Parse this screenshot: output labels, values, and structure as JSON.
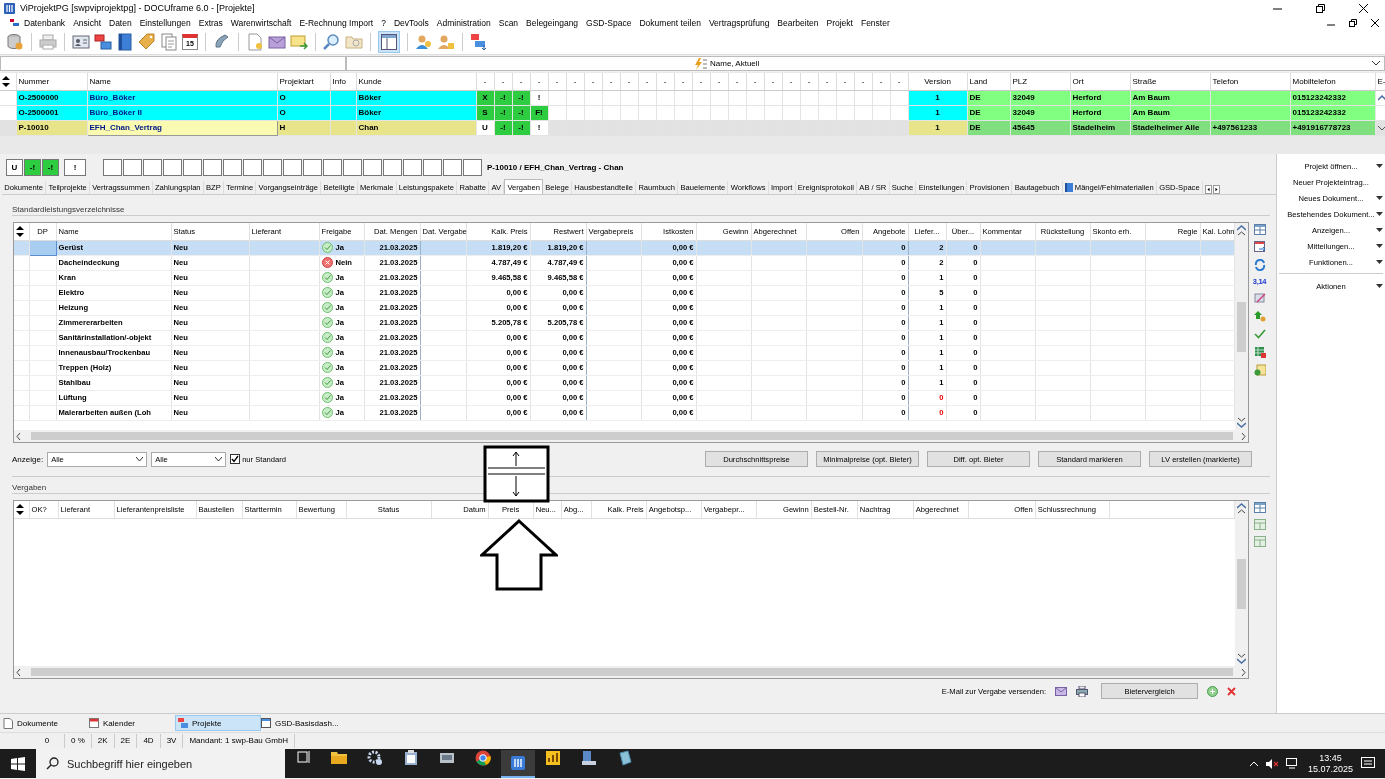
{
  "window": {
    "title": "ViProjektPG [swpviprojektpg] - DOCUframe 6.0 - [Projekte]"
  },
  "menu": [
    "Datenbank",
    "Ansicht",
    "Daten",
    "Einstellungen",
    "Extras",
    "Warenwirtschaft",
    "E-Rechnung Import",
    "?",
    "DevTools",
    "Administration",
    "Scan",
    "Belegeingang",
    "GSD-Space",
    "Dokument teilen",
    "Vertragsprüfung",
    "Bearbeiten",
    "Projekt",
    "Fenster"
  ],
  "toolbar": {
    "calendar_day": "15"
  },
  "filter_bar": {
    "sort_value": "Name, Aktuell"
  },
  "projects": {
    "columns": [
      "Nummer",
      "Name",
      "Projektart",
      "Info",
      "Kunde"
    ],
    "flag_columns": [
      "-",
      "-",
      "-",
      "-",
      "-",
      "-",
      "-",
      "-",
      "-",
      "-",
      "-",
      "-",
      "-",
      "-",
      "-",
      "-",
      "-",
      "-",
      "-",
      "-",
      "-",
      "-",
      "-",
      "-"
    ],
    "address_columns": [
      "Version",
      "Land",
      "PLZ",
      "Ort",
      "Straße",
      "Telefon",
      "Mobiltelefon",
      "E-"
    ],
    "rows": [
      {
        "nummer": "O-2500000",
        "name": "Büro_Böker",
        "projektart": "O",
        "kunde": "Böker",
        "color": "#00ffff",
        "selected": false,
        "flags": [
          {
            "text": "X",
            "on": true
          },
          {
            "text": "-!",
            "on": true
          },
          {
            "text": "-!",
            "on": true
          },
          {
            "text": "!",
            "on": false
          }
        ],
        "version": "1",
        "land": "DE",
        "plz": "32049",
        "ort": "Herford",
        "strasse": "Am Baum",
        "mobil": "015123242332"
      },
      {
        "nummer": "O-2500001",
        "name": "Büro_Böker II",
        "projektart": "O",
        "kunde": "Böker",
        "color": "#00ffff",
        "selected": false,
        "flags": [
          {
            "text": "S",
            "on": true
          },
          {
            "text": "-!",
            "on": true
          },
          {
            "text": "-!",
            "on": true
          },
          {
            "text": "F!",
            "on": true
          }
        ],
        "version": "1",
        "land": "DE",
        "plz": "32049",
        "ort": "Herford",
        "strasse": "Am Baum",
        "mobil": "015123242332"
      },
      {
        "nummer": "P-10010",
        "name": "EFH_Chan_Vertrag",
        "projektart": "H",
        "kunde": "Chan",
        "color": "#e8e48a",
        "selected": true,
        "flags": [
          {
            "text": "U",
            "on": false
          },
          {
            "text": "-!",
            "on": true
          },
          {
            "text": "-!",
            "on": true
          },
          {
            "text": "!",
            "on": false
          }
        ],
        "version": "1",
        "land": "DE",
        "plz": "45645",
        "ort": "Stadelheim",
        "strasse": "Stadelheimer Alle",
        "telefon": "+497561233",
        "mobil": "+491916778723"
      }
    ]
  },
  "project_header": {
    "status_boxes": [
      {
        "text": "U",
        "on": false
      },
      {
        "text": "-!",
        "on": true
      },
      {
        "text": "-!",
        "on": true
      },
      {
        "text": "!",
        "on": false
      }
    ],
    "title": "P-10010 / EFH_Chan_Vertrag - Chan"
  },
  "tabs": [
    {
      "label": "Dokumente",
      "selected": false
    },
    {
      "label": "Teilprojekte",
      "selected": false
    },
    {
      "label": "Vertragssummen",
      "selected": false
    },
    {
      "label": "Zahlungsplan",
      "selected": false
    },
    {
      "label": "BZP",
      "selected": false
    },
    {
      "label": "Termine",
      "selected": false
    },
    {
      "label": "Vorgangseinträge",
      "selected": false
    },
    {
      "label": "Beteiligte",
      "selected": false
    },
    {
      "label": "Merkmale",
      "selected": false
    },
    {
      "label": "Leistungspakete",
      "selected": false
    },
    {
      "label": "Rabatte",
      "selected": false
    },
    {
      "label": "AV",
      "selected": false
    },
    {
      "label": "Vergaben",
      "selected": true
    },
    {
      "label": "Belege",
      "selected": false
    },
    {
      "label": "Hausbestandteile",
      "selected": false
    },
    {
      "label": "Raumbuch",
      "selected": false
    },
    {
      "label": "Bauelemente",
      "selected": false
    },
    {
      "label": "Workflows",
      "selected": false
    },
    {
      "label": "Import",
      "selected": false
    },
    {
      "label": "Ereignisprotokoll",
      "selected": false
    },
    {
      "label": "AB / SR",
      "selected": false
    },
    {
      "label": "Suche",
      "selected": false
    },
    {
      "label": "Einstellungen",
      "selected": false
    },
    {
      "label": "Provisionen",
      "selected": false
    },
    {
      "label": "Bautagebuch",
      "selected": false
    },
    {
      "label": "Mängel/Fehlmaterialien",
      "selected": false
    },
    {
      "label": "GSD-Space",
      "selected": false
    }
  ],
  "lv": {
    "title": "Standardleistungsverzeichnisse",
    "tool_number": "3,14",
    "columns": [
      "DP",
      "Name",
      "Status",
      "Lieferant",
      "Freigabe",
      "Dat. Mengen",
      "Dat. Vergabe",
      "Kalk. Preis",
      "Restwert",
      "Vergabepreis",
      "Istkosten",
      "Gewinn",
      "Abgerechnet",
      "Offen",
      "Angebote",
      "Liefer...",
      "Über...",
      "Kommentar",
      "Rückstellung",
      "Skonto erh.",
      "Regie",
      "Kal. Lohn"
    ],
    "rows": [
      {
        "name": "Gerüst",
        "status": "Neu",
        "freigabe": "Ja",
        "approved": true,
        "dat_mengen": "21.03.2025",
        "kalk_preis": "1.819,20 €",
        "restwert": "1.819,20 €",
        "istkosten": "0,00 €",
        "angebote": "0",
        "lieferanten": "2",
        "lieferanten_alert": false,
        "ueber": "0",
        "selected": true
      },
      {
        "name": "Dacheindeckung",
        "status": "Neu",
        "freigabe": "Nein",
        "approved": false,
        "dat_mengen": "21.03.2025",
        "kalk_preis": "4.787,49 €",
        "restwert": "4.787,49 €",
        "istkosten": "0,00 €",
        "angebote": "0",
        "lieferanten": "2",
        "lieferanten_alert": false,
        "ueber": "0",
        "selected": false
      },
      {
        "name": "Kran",
        "status": "Neu",
        "freigabe": "Ja",
        "approved": true,
        "dat_mengen": "21.03.2025",
        "kalk_preis": "9.465,58 €",
        "restwert": "9.465,58 €",
        "istkosten": "0,00 €",
        "angebote": "0",
        "lieferanten": "1",
        "lieferanten_alert": false,
        "ueber": "0",
        "selected": false
      },
      {
        "name": "Elektro",
        "status": "Neu",
        "freigabe": "Ja",
        "approved": true,
        "dat_mengen": "21.03.2025",
        "kalk_preis": "0,00 €",
        "restwert": "0,00 €",
        "istkosten": "0,00 €",
        "angebote": "0",
        "lieferanten": "5",
        "lieferanten_alert": false,
        "ueber": "0",
        "selected": false
      },
      {
        "name": "Heizung",
        "status": "Neu",
        "freigabe": "Ja",
        "approved": true,
        "dat_mengen": "21.03.2025",
        "kalk_preis": "0,00 €",
        "restwert": "0,00 €",
        "istkosten": "0,00 €",
        "angebote": "0",
        "lieferanten": "1",
        "lieferanten_alert": false,
        "ueber": "0",
        "selected": false
      },
      {
        "name": "Zimmererarbeiten",
        "status": "Neu",
        "freigabe": "Ja",
        "approved": true,
        "dat_mengen": "21.03.2025",
        "kalk_preis": "5.205,78 €",
        "restwert": "5.205,78 €",
        "istkosten": "0,00 €",
        "angebote": "0",
        "lieferanten": "1",
        "lieferanten_alert": false,
        "ueber": "0",
        "selected": false
      },
      {
        "name": "Sanitärinstallation/-objekt",
        "status": "Neu",
        "freigabe": "Ja",
        "approved": true,
        "dat_mengen": "21.03.2025",
        "kalk_preis": "0,00 €",
        "restwert": "0,00 €",
        "istkosten": "0,00 €",
        "angebote": "0",
        "lieferanten": "1",
        "lieferanten_alert": false,
        "ueber": "0",
        "selected": false
      },
      {
        "name": "Innenausbau/Trockenbau",
        "status": "Neu",
        "freigabe": "Ja",
        "approved": true,
        "dat_mengen": "21.03.2025",
        "kalk_preis": "0,00 €",
        "restwert": "0,00 €",
        "istkosten": "0,00 €",
        "angebote": "0",
        "lieferanten": "1",
        "lieferanten_alert": false,
        "ueber": "0",
        "selected": false
      },
      {
        "name": "Treppen (Holz)",
        "status": "Neu",
        "freigabe": "Ja",
        "approved": true,
        "dat_mengen": "21.03.2025",
        "kalk_preis": "0,00 €",
        "restwert": "0,00 €",
        "istkosten": "0,00 €",
        "angebote": "0",
        "lieferanten": "1",
        "lieferanten_alert": false,
        "ueber": "0",
        "selected": false
      },
      {
        "name": "Stahlbau",
        "status": "Neu",
        "freigabe": "Ja",
        "approved": true,
        "dat_mengen": "21.03.2025",
        "kalk_preis": "0,00 €",
        "restwert": "0,00 €",
        "istkosten": "0,00 €",
        "angebote": "0",
        "lieferanten": "1",
        "lieferanten_alert": false,
        "ueber": "0",
        "selected": false
      },
      {
        "name": "Lüftung",
        "status": "Neu",
        "freigabe": "Ja",
        "approved": true,
        "dat_mengen": "21.03.2025",
        "kalk_preis": "0,00 €",
        "restwert": "0,00 €",
        "istkosten": "0,00 €",
        "angebote": "0",
        "lieferanten": "0",
        "lieferanten_alert": true,
        "ueber": "0",
        "selected": false
      },
      {
        "name": "Malerarbeiten außen (Loh",
        "status": "Neu",
        "freigabe": "Ja",
        "approved": true,
        "dat_mengen": "21.03.2025",
        "kalk_preis": "0,00 €",
        "restwert": "0,00 €",
        "istkosten": "0,00 €",
        "angebote": "0",
        "lieferanten": "0",
        "lieferanten_alert": true,
        "ueber": "0",
        "selected": false
      }
    ]
  },
  "filters": {
    "label": "Anzeige:",
    "selects": [
      "Alle",
      "Alle"
    ],
    "checkbox": {
      "label": "nur Standard",
      "checked": true
    },
    "buttons": [
      "Durchschnittspreise",
      "Minimalpreise (opt. Bieter)",
      "Diff. opt. Bieter",
      "Standard markieren",
      "LV erstellen (markierte)"
    ]
  },
  "vergaben": {
    "title": "Vergaben",
    "columns": [
      "OK?",
      "Lieferant",
      "Lieferantenpreisliste",
      "Baustellen",
      "Starttermin",
      "Bewertung",
      "Status",
      "Datum",
      "Preis",
      "Neu...",
      "Abg...",
      "Kalk. Preis",
      "Angebotsp...",
      "Vergabepr...",
      "Gewinn",
      "Bestell-Nr.",
      "Nachtrag",
      "Abgerechnet",
      "Offen",
      "Schlussrechnung"
    ],
    "email_label": "E-Mail zur Vergabe versenden:",
    "compare_button": "Bietervergleich"
  },
  "side_panel": {
    "items": [
      {
        "label": "Projekt öffnen...",
        "dropdown": true
      },
      {
        "label": "Neuer Projekteintrag...",
        "dropdown": false
      },
      {
        "label": "Neues Dokument...",
        "dropdown": true
      },
      {
        "label": "Bestehendes Dokument...",
        "dropdown": true
      },
      {
        "label": "Anzeigen...",
        "dropdown": true
      },
      {
        "label": "Mitteilungen...",
        "dropdown": true
      },
      {
        "label": "Funktionen...",
        "dropdown": true
      }
    ],
    "section": {
      "label": "Aktionen",
      "dropdown": true
    }
  },
  "bottom_tabs": [
    {
      "label": "Dokumente",
      "selected": false
    },
    {
      "label": "Kalender",
      "selected": false
    },
    {
      "label": "Projekte",
      "selected": true
    },
    {
      "label": "GSD-Basisdash...",
      "selected": false
    }
  ],
  "status_bar": [
    "0",
    "0 %",
    "2K",
    "2E",
    "4D",
    "3V",
    "Mandant: 1 swp-Bau GmbH"
  ],
  "taskbar": {
    "search": {
      "placeholder": "Suchbegriff hier eingeben"
    },
    "time": "13:45",
    "date": "15.07.2025"
  }
}
